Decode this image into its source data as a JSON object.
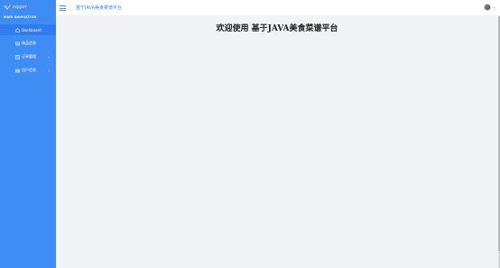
{
  "sidebar": {
    "brand_text": "zqqsrr",
    "section_label": "MAIN NAVIGATION",
    "items": [
      {
        "label": "Dashboard",
        "icon": "home-icon",
        "active": true
      },
      {
        "label": "商品信息",
        "icon": "image-icon",
        "active": false
      },
      {
        "label": "订单管理",
        "icon": "list-icon",
        "active": false,
        "expandable": true
      },
      {
        "label": "用户信息",
        "icon": "user-card-icon",
        "active": false,
        "expandable": true
      }
    ]
  },
  "header": {
    "title": "基于JAVA美食菜谱平台",
    "caret": "⌄"
  },
  "main": {
    "welcome": "欢迎使用 基于JAVA美食菜谱平台"
  },
  "colors": {
    "sidebar_bg": "#3f8cf4",
    "active_bg": "#2f7cf0",
    "accent": "#3f8cf4",
    "content_bg": "#f1f3f7"
  }
}
